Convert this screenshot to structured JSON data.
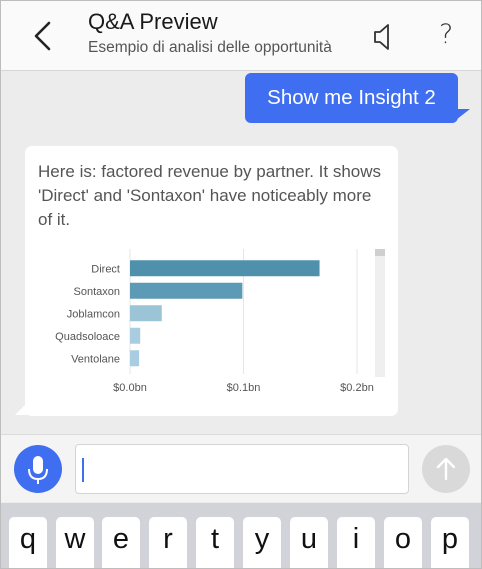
{
  "header": {
    "title": "Q&A Preview",
    "subtitle": "Esempio di analisi delle opportunità",
    "back_icon": "chevron-left-icon",
    "speaker_icon": "speaker-icon",
    "help_label": "?"
  },
  "chat": {
    "user_message": "Show me Insight 2",
    "bot_message": "Here is: factored revenue by partner. It shows 'Direct' and 'Sontaxon' have noticeably more of it."
  },
  "chart_data": {
    "type": "bar",
    "orientation": "horizontal",
    "categories": [
      "Direct",
      "Sontaxon",
      "Joblamcon",
      "Quadsoloace",
      "Ventolane"
    ],
    "values": [
      0.167,
      0.099,
      0.028,
      0.009,
      0.008
    ],
    "unit": "bn",
    "x_ticks": [
      "$0.0bn",
      "$0.1bn",
      "$0.2bn"
    ],
    "xlim": [
      0,
      0.2
    ],
    "grid": "vertical",
    "bar_colors": [
      "#4f91ad",
      "#5c9ab6",
      "#9cc4d7",
      "#a9cde0",
      "#a9cde0"
    ]
  },
  "input": {
    "placeholder": "",
    "mic_icon": "microphone-icon",
    "send_icon": "arrow-up-icon"
  },
  "keyboard": {
    "keys": [
      "q",
      "w",
      "e",
      "r",
      "t",
      "y",
      "u",
      "i",
      "o",
      "p"
    ]
  },
  "colors": {
    "accent": "#3f6ff0",
    "background": "#ececec"
  }
}
